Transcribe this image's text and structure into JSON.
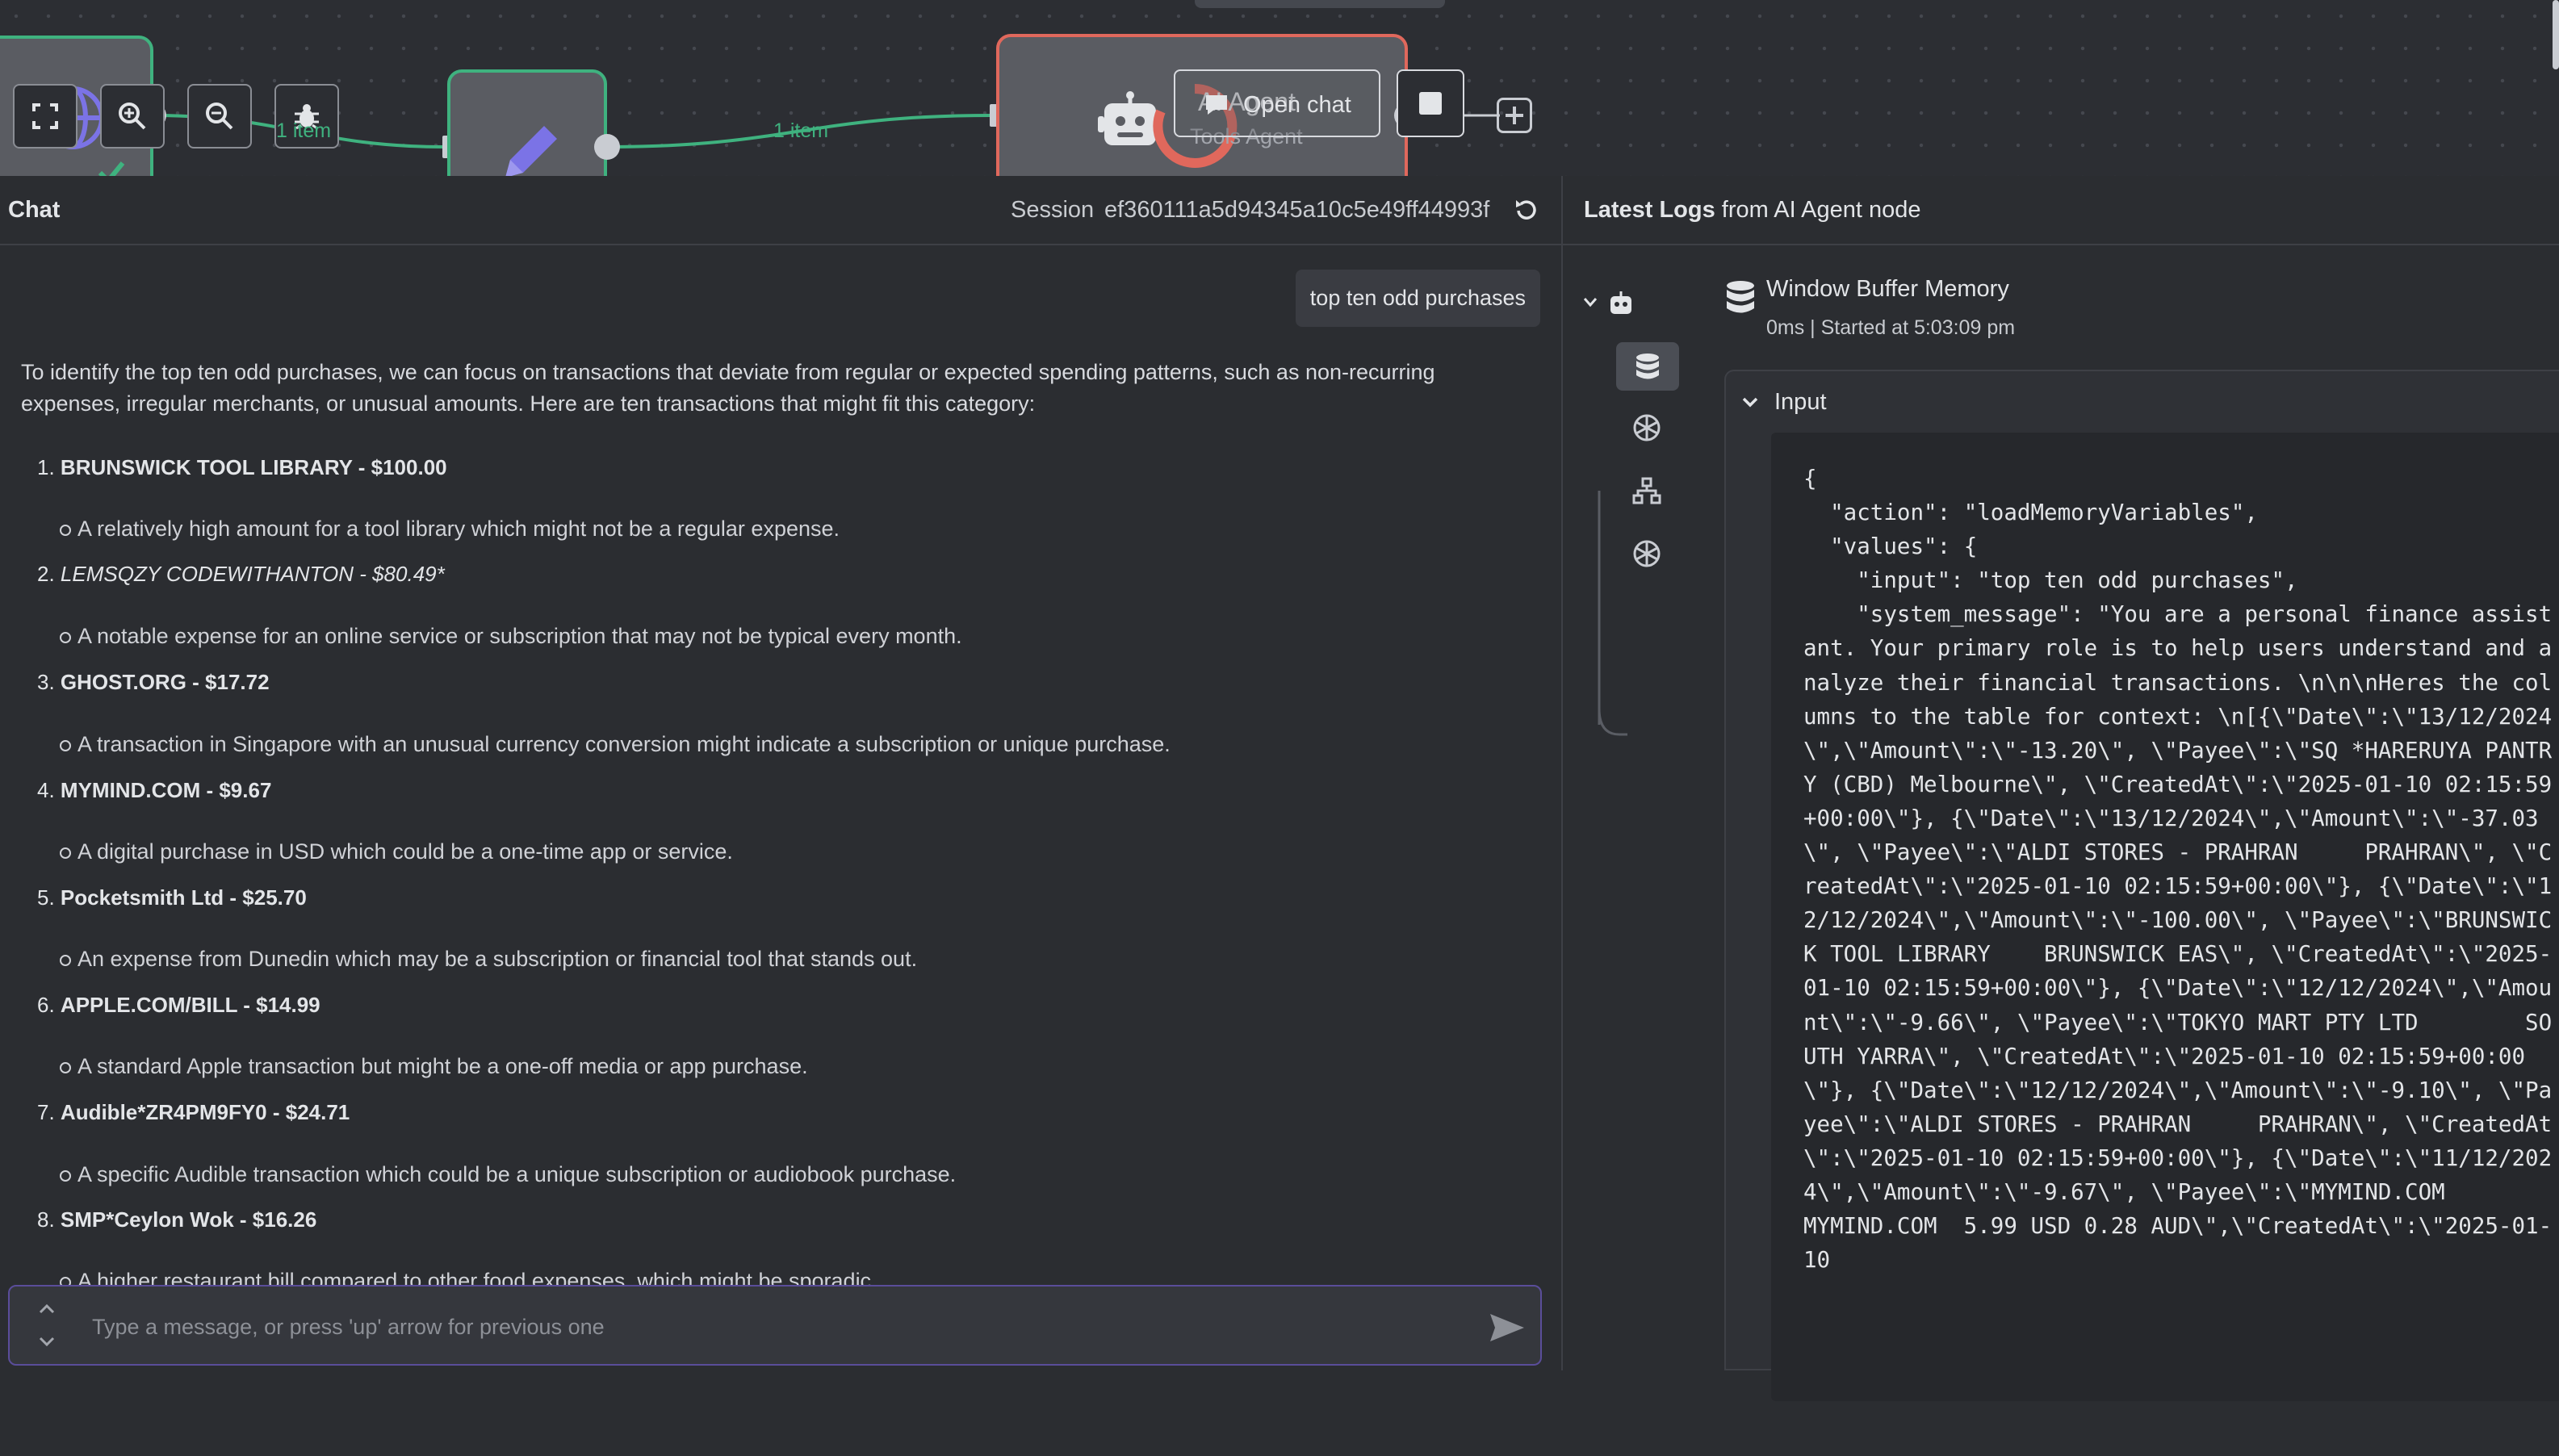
{
  "canvas": {
    "connection_label": "1 item",
    "agent_node": {
      "title": "AI Agent",
      "subtitle": "Tools Agent"
    },
    "open_chat_label": "Open chat"
  },
  "chat": {
    "title": "Chat",
    "session_label": "Session",
    "session_id": "ef360111a5d94345a10c5e49ff44993f",
    "user_message": "top ten odd purchases",
    "intro": "To identify the top ten odd purchases, we can focus on transactions that deviate from regular or expected spending patterns, such as non-recurring expenses, irregular merchants, or unusual amounts. Here are ten transactions that might fit this category:",
    "items": [
      {
        "num": "1.",
        "title": "BRUNSWICK TOOL LIBRARY - $100.00",
        "desc": "A relatively high amount for a tool library which might not be a regular expense."
      },
      {
        "num": "2.",
        "title": "LEMSQZY CODEWITHANTON - $80.49*",
        "desc": "A notable expense for an online service or subscription that may not be typical every month."
      },
      {
        "num": "3.",
        "title": "GHOST.ORG - $17.72",
        "desc": "A transaction in Singapore with an unusual currency conversion might indicate a subscription or unique purchase."
      },
      {
        "num": "4.",
        "title": "MYMIND.COM - $9.67",
        "desc": "A digital purchase in USD which could be a one-time app or service."
      },
      {
        "num": "5.",
        "title": "Pocketsmith Ltd - $25.70",
        "desc": "An expense from Dunedin which may be a subscription or financial tool that stands out."
      },
      {
        "num": "6.",
        "title": "APPLE.COM/BILL - $14.99",
        "desc": "A standard Apple transaction but might be a one-off media or app purchase."
      },
      {
        "num": "7.",
        "title": "Audible*ZR4PM9FY0 - $24.71",
        "desc": "A specific Audible transaction which could be a unique subscription or audiobook purchase."
      },
      {
        "num": "8.",
        "title": "SMP*Ceylon Wok - $16.26",
        "desc": "A higher restaurant bill compared to other food expenses, which might be sporadic."
      }
    ],
    "input_placeholder": "Type a message, or press 'up' arrow for previous one"
  },
  "logs": {
    "title_bold": "Latest Logs",
    "title_rest": " from AI Agent node",
    "entry_title": "Window Buffer Memory",
    "entry_meta": "0ms | Started at 5:03:09 pm",
    "section_label": "Input",
    "json": "{\n  \"action\": \"loadMemoryVariables\",\n  \"values\": {\n    \"input\": \"top ten odd purchases\",\n    \"system_message\": \"You are a personal finance assistant. Your primary role is to help users understand and analyze their financial transactions. \\n\\n\\nHeres the columns to the table for context: \\n[{\\\"Date\\\":\\\"13/12/2024\\\",\\\"Amount\\\":\\\"-13.20\\\", \\\"Payee\\\":\\\"SQ *HARERUYA PANTRY (CBD) Melbourne\\\", \\\"CreatedAt\\\":\\\"2025-01-10 02:15:59+00:00\\\"}, {\\\"Date\\\":\\\"13/12/2024\\\",\\\"Amount\\\":\\\"-37.03\\\", \\\"Payee\\\":\\\"ALDI STORES - PRAHRAN     PRAHRAN\\\", \\\"CreatedAt\\\":\\\"2025-01-10 02:15:59+00:00\\\"}, {\\\"Date\\\":\\\"12/12/2024\\\",\\\"Amount\\\":\\\"-100.00\\\", \\\"Payee\\\":\\\"BRUNSWICK TOOL LIBRARY    BRUNSWICK EAS\\\", \\\"CreatedAt\\\":\\\"2025-01-10 02:15:59+00:00\\\"}, {\\\"Date\\\":\\\"12/12/2024\\\",\\\"Amount\\\":\\\"-9.66\\\", \\\"Payee\\\":\\\"TOKYO MART PTY LTD        SOUTH YARRA\\\", \\\"CreatedAt\\\":\\\"2025-01-10 02:15:59+00:00\\\"}, {\\\"Date\\\":\\\"12/12/2024\\\",\\\"Amount\\\":\\\"-9.10\\\", \\\"Payee\\\":\\\"ALDI STORES - PRAHRAN     PRAHRAN\\\", \\\"CreatedAt\\\":\\\"2025-01-10 02:15:59+00:00\\\"}, {\\\"Date\\\":\\\"11/12/2024\\\",\\\"Amount\\\":\\\"-9.67\\\", \\\"Payee\\\":\\\"MYMIND.COM                MYMIND.COM  5.99 USD 0.28 AUD\\\",\\\"CreatedAt\\\":\\\"2025-01-10"
  },
  "icons": {
    "globe": "globe-icon",
    "pencil": "pencil-icon",
    "robot": "robot-icon",
    "zoom_in": "zoom-in-icon",
    "zoom_out": "zoom-out-icon",
    "bug": "bug-icon",
    "fit": "fit-view-icon",
    "reset": "reset-icon",
    "database": "database-icon",
    "openai": "openai-icon",
    "network": "network-icon",
    "send": "send-icon",
    "chevron": "chevron-down-icon",
    "plus": "plus-icon",
    "stop": "stop-icon"
  },
  "colors": {
    "accent_green": "#3fb27f",
    "agent_border": "#e0685c",
    "input_border": "#5a4d9a",
    "pencil_purple": "#7b73e6"
  }
}
